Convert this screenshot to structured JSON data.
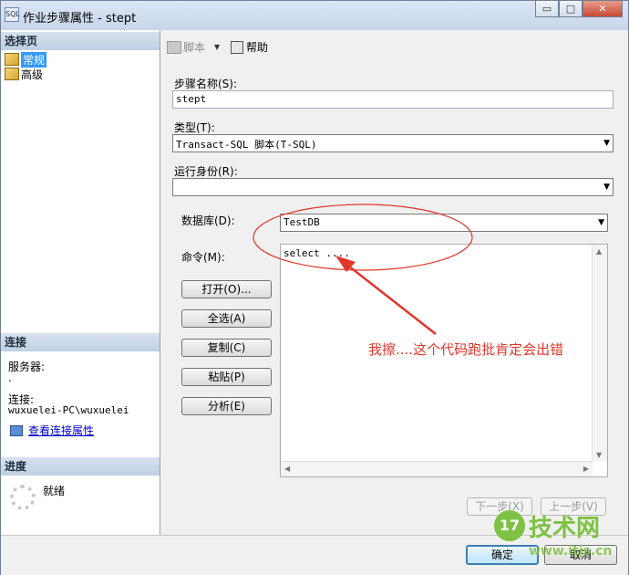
{
  "window": {
    "title": "作业步骤属性 - stept",
    "app_icon_label": "SQL",
    "controls": {
      "minimize": "▭",
      "maximize": "□",
      "close": "✕"
    }
  },
  "left_pane": {
    "select_page_header": "选择页",
    "pages": [
      {
        "label": "常规",
        "selected": true
      },
      {
        "label": "高级",
        "selected": false
      }
    ],
    "connection_header": "连接",
    "server_label": "服务器:",
    "server_value": ".",
    "connection_label": "连接:",
    "connection_value": "wuxuelei-PC\\wuxuelei",
    "view_connection_link": "查看连接属性",
    "progress_header": "进度",
    "progress_status": "就绪"
  },
  "toolbar": {
    "script_label": "脚本",
    "help_label": "帮助"
  },
  "form": {
    "step_name_label": "步骤名称(S):",
    "step_name_value": "stept",
    "type_label": "类型(T):",
    "type_value": "Transact-SQL 脚本(T-SQL)",
    "run_as_label": "运行身份(R):",
    "run_as_value": "",
    "database_label": "数据库(D):",
    "database_value": "TestDB",
    "command_label": "命令(M):",
    "command_text": "select ....",
    "buttons": {
      "open": "打开(O)...",
      "select_all": "全选(A)",
      "copy": "复制(C)",
      "paste": "粘贴(P)",
      "parse": "分析(E)"
    },
    "next_button": "下一步(X)",
    "prev_button": "上一步(V)"
  },
  "footer": {
    "ok_button": "确定",
    "cancel_button": "取消"
  },
  "annotation": {
    "text": "我擦....这个代码跑批肯定会出错",
    "color": "#e0362b"
  },
  "watermark": {
    "logo_text": "17",
    "brand": "技术网",
    "url": "www.itjs.cn"
  },
  "colors": {
    "selection": "#3399ff",
    "section_header": "#c0cfe3",
    "link": "#0000cc"
  }
}
